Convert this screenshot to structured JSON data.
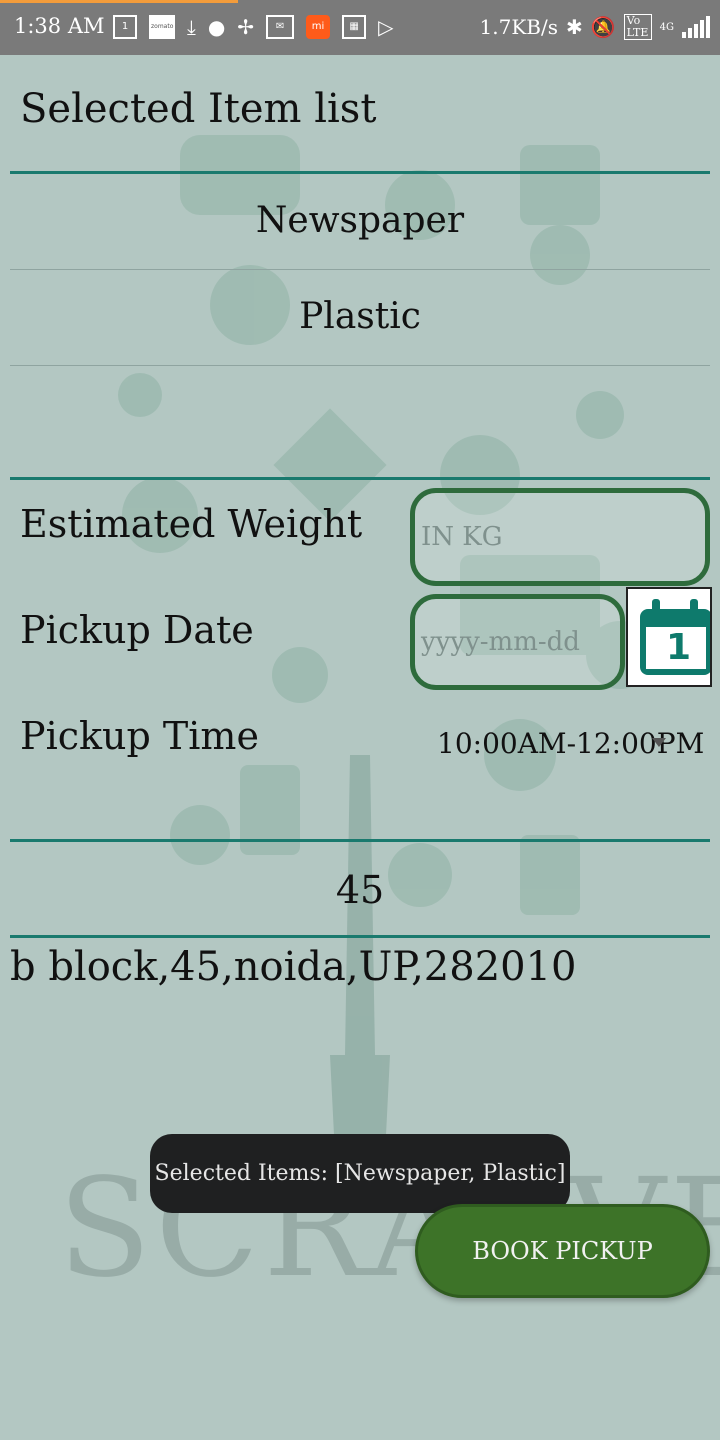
{
  "status_bar": {
    "time": "1:38 AM",
    "net_speed": "1.7KB/s",
    "network": "4G",
    "volte": "Vo LTE",
    "notification_icons": [
      "calendar-1-icon",
      "zomato-icon",
      "download-icon",
      "swiggy-icon",
      "pinwheel-icon",
      "gmail-icon",
      "mi-icon",
      "calendar-icon",
      "play-store-icon"
    ],
    "zomato_text": "zomato"
  },
  "header": {
    "title": "Selected Item list"
  },
  "selected_items": [
    "Newspaper",
    "Plastic"
  ],
  "form": {
    "weight_label": "Estimated Weight",
    "weight_placeholder": "IN KG",
    "date_label": "Pickup Date",
    "date_placeholder": "yyyy-mm-dd",
    "calendar_number": "1",
    "time_label": "Pickup Time",
    "time_value": "10:00AM-12:00PM"
  },
  "house_number": "45",
  "address": "b block,45,noida,UP,282010",
  "brand": "SCRAPVEND",
  "toast": "Selected Items: [Newspaper, Plastic]",
  "book_button": "BOOK PICKUP",
  "colors": {
    "accent": "#1a7a6e",
    "button": "#3d7328",
    "background": "#b3c7c2"
  }
}
